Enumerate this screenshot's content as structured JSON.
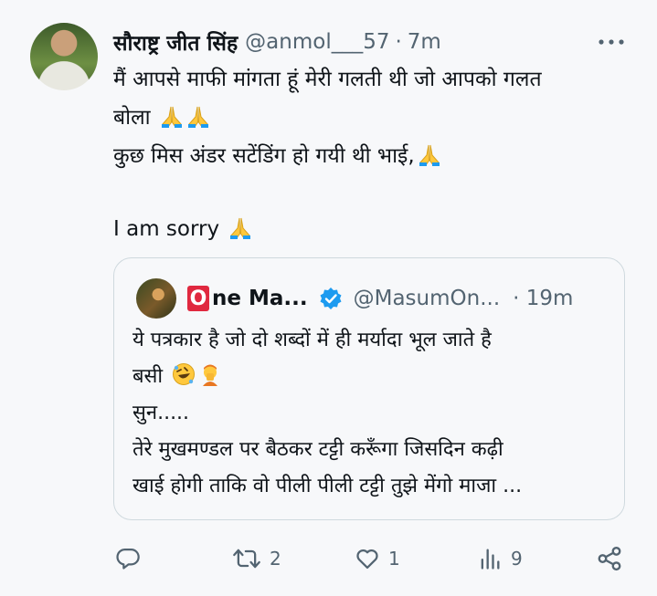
{
  "tweet": {
    "author_name": "सौराष्ट्र जीत सिंह",
    "author_handle": "@anmol___57",
    "separator": "·",
    "time": "7m",
    "lines": [
      "मैं आपसे माफी मांगता हूं मेरी गलती थी जो आपको गलत",
      "बोला",
      "कुछ मिस अंडर सटेंडिंग हो गयी थी भाई,",
      "I am sorry"
    ]
  },
  "quote": {
    "author_badge_letter": "O",
    "author_name": "ne Ma...",
    "author_handle": "@MasumOn...",
    "separator": "·",
    "time": "19m",
    "lines": [
      "ये पत्रकार है जो दो शब्दों में ही मर्यादा भूल जाते है",
      "बसी",
      "सुन.....",
      "तेरे मुखमण्डल पर बैठकर टट्टी करूँगा जिसदिन कढ़ी",
      "खाई होगी ताकि वो पीली पीली टट्टी तुझे मेंगो माजा ..."
    ]
  },
  "actions": {
    "reply": {
      "icon": "reply-icon",
      "count": ""
    },
    "retweet": {
      "icon": "retweet-icon",
      "count": "2"
    },
    "like": {
      "icon": "heart-icon",
      "count": "1"
    },
    "views": {
      "icon": "views-icon",
      "count": "9"
    },
    "share": {
      "icon": "share-icon",
      "count": ""
    }
  },
  "colors": {
    "text": "#0f1419",
    "muted": "#536471",
    "verified": "#1d9bf0",
    "badge_red": "#e0283f",
    "emoji_yellow": "#ffc83d"
  }
}
